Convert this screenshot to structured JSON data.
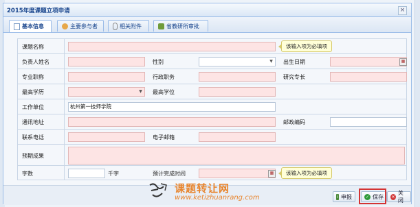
{
  "window": {
    "title": "2015年度课题立项申请",
    "close_glyph": "×"
  },
  "tabs": [
    {
      "label": "基本信息",
      "icon": "document-icon",
      "active": true
    },
    {
      "label": "主要参与者",
      "icon": "users-icon"
    },
    {
      "label": "相关附件",
      "icon": "paperclip-icon"
    },
    {
      "label": "省教研所审批",
      "icon": "approve-icon"
    }
  ],
  "form": {
    "topic_name_label": "课题名称",
    "leader_name_label": "负责人姓名",
    "gender_label": "性别",
    "birth_date_label": "出生日期",
    "title_label": "专业职称",
    "admin_post_label": "行政职务",
    "research_label": "研究专长",
    "education_label": "最高学历",
    "degree_label": "最高学位",
    "workplace_label": "工作单位",
    "workplace_value": "杭州第一技师学院",
    "address_label": "通讯地址",
    "postcode_label": "邮政编码",
    "phone_label": "联系电话",
    "email_label": "电子邮箱",
    "results_label": "预期成果",
    "wordcount_label": "字数",
    "wordcount_unit": "千字",
    "finish_time_label": "预计完成时间",
    "required_tip": "该输入项为必填项"
  },
  "footer": {
    "apply_label": "申报",
    "save_label": "保存",
    "close_label": "关闭"
  },
  "watermark": {
    "cn": "课题转让网",
    "en": "www.ketizhuanrang.com",
    "logo": "课题"
  },
  "colors": {
    "required_bg": "#fde4e4",
    "title_text": "#15428b",
    "highlight": "#d43333",
    "watermark": "#e8852e"
  }
}
